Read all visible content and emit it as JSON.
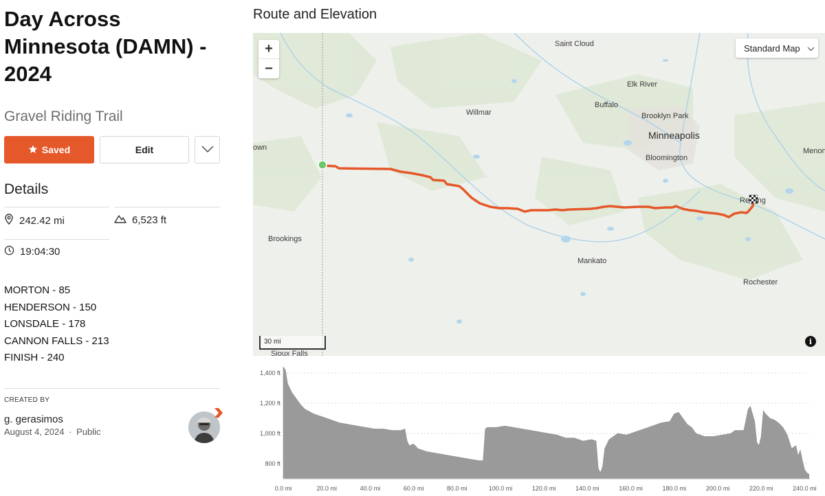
{
  "route": {
    "title": "Day Across Minnesota (DAMN) - 2024",
    "type": "Gravel Riding Trail",
    "saved_label": "Saved",
    "edit_label": "Edit"
  },
  "details": {
    "heading": "Details",
    "distance": "242.42 mi",
    "elevation_gain": "6,523 ft",
    "moving_time": "19:04:30",
    "notes": [
      "MORTON - 85",
      "HENDERSON - 150",
      "LONSDALE - 178",
      "CANNON FALLS - 213",
      "FINISH - 240"
    ]
  },
  "creator": {
    "label": "CREATED BY",
    "name": "g. gerasimos",
    "date": "August 4, 2024",
    "visibility": "Public",
    "separator": "·"
  },
  "map": {
    "section_title": "Route and Elevation",
    "map_type": "Standard Map",
    "zoom_in": "+",
    "zoom_out": "−",
    "scale": "30 mi",
    "info": "i",
    "places": {
      "saint_cloud": "Saint Cloud",
      "elk_river": "Elk River",
      "buffalo": "Buffalo",
      "willmar": "Willmar",
      "brooklyn_park": "Brooklyn Park",
      "minneapolis": "Minneapolis",
      "bloomington": "Bloomington",
      "menomonie": "Menon",
      "own": "own",
      "red_wing": "Re   ing",
      "brookings": "Brookings",
      "mankato": "Mankato",
      "rochester": "Rochester",
      "sioux_falls": "Sioux Falls"
    },
    "route_color": "#e5582a",
    "start_color": "#6cc76a"
  },
  "elevation": {
    "y_labels": [
      "1,400 ft",
      "1,200 ft",
      "1,000 ft",
      "800 ft"
    ],
    "x_labels": [
      "0.0 mi",
      "20.0 mi",
      "40.0 mi",
      "60.0 mi",
      "80.0 mi",
      "100.0 mi",
      "120.0 mi",
      "140.0 mi",
      "160.0 mi",
      "180.0 mi",
      "200.0 mi",
      "220.0 mi",
      "240.0 mi"
    ],
    "fill_color": "#9a9a9a"
  },
  "chart_data": {
    "type": "area",
    "x_unit": "mi",
    "y_unit": "ft",
    "xlim": [
      0,
      242.42
    ],
    "ylim": [
      700,
      1450
    ],
    "x": [
      0,
      1,
      2,
      4,
      6,
      8,
      10,
      14,
      18,
      22,
      26,
      30,
      34,
      38,
      42,
      46,
      50,
      54,
      56,
      57,
      58,
      60,
      62,
      66,
      70,
      74,
      78,
      82,
      86,
      90,
      92,
      93,
      94,
      98,
      102,
      106,
      110,
      114,
      118,
      122,
      126,
      130,
      134,
      138,
      142,
      144,
      145,
      146,
      147,
      148,
      149,
      150,
      154,
      158,
      162,
      166,
      170,
      174,
      178,
      180,
      182,
      184,
      186,
      188,
      190,
      194,
      198,
      202,
      206,
      208,
      210,
      212,
      214,
      215,
      216,
      217,
      218,
      219,
      220,
      221,
      222,
      224,
      226,
      228,
      230,
      232,
      234,
      236,
      237,
      238,
      239,
      240,
      241,
      242
    ],
    "values": [
      1440,
      1420,
      1330,
      1270,
      1230,
      1190,
      1160,
      1130,
      1110,
      1090,
      1070,
      1060,
      1050,
      1040,
      1030,
      1030,
      1020,
      1020,
      1030,
      950,
      920,
      930,
      900,
      880,
      870,
      860,
      850,
      840,
      830,
      820,
      820,
      1030,
      1040,
      1040,
      1050,
      1040,
      1030,
      1020,
      1010,
      1000,
      990,
      970,
      970,
      950,
      960,
      950,
      770,
      740,
      780,
      900,
      930,
      960,
      1000,
      990,
      1010,
      1030,
      1050,
      1070,
      1080,
      1130,
      1140,
      1100,
      1060,
      1040,
      1000,
      980,
      980,
      990,
      1000,
      1020,
      1020,
      1020,
      1160,
      1180,
      1130,
      1080,
      940,
      920,
      980,
      1150,
      1130,
      1100,
      1090,
      1070,
      1040,
      990,
      900,
      920,
      850,
      890,
      820,
      760,
      740,
      730
    ]
  }
}
